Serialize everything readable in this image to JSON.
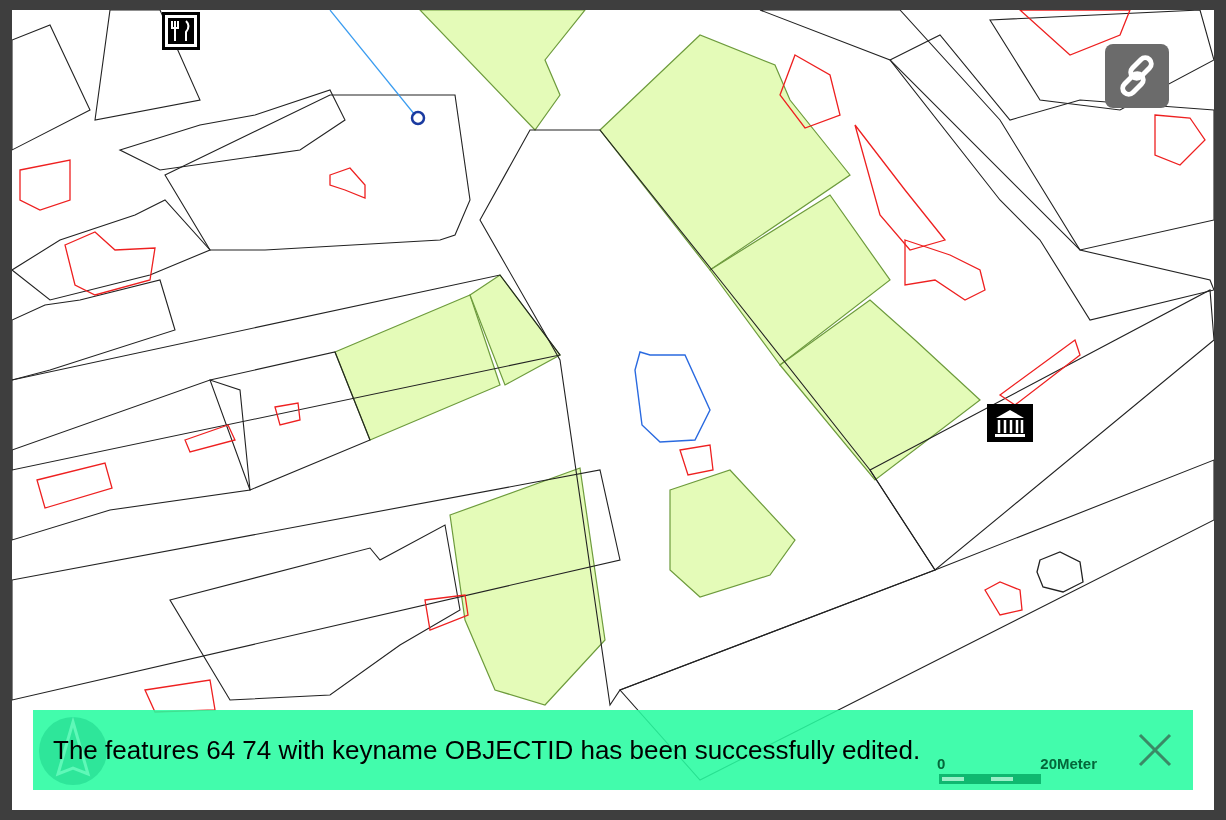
{
  "map": {
    "scale_bar": {
      "start": "0",
      "end": "20Meter"
    }
  },
  "notification": {
    "message": "The features 64 74 with keyname OBJECTID has been successfully edited."
  }
}
